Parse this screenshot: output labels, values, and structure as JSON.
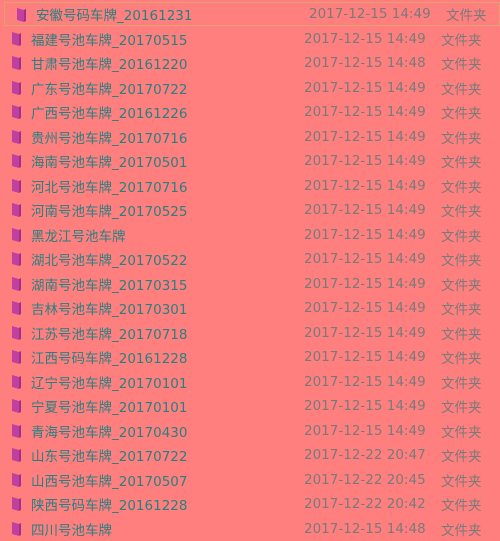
{
  "colors": {
    "background": "#ff7f7f",
    "name_text": "#2a8080",
    "meta_text": "#7a7a7a",
    "folder_icon": "#c040a0"
  },
  "files": [
    {
      "name": "安徽号码车牌_20161231",
      "date": "2017-12-15 14:49",
      "type": "文件夹",
      "selected": true
    },
    {
      "name": "福建号池车牌_20170515",
      "date": "2017-12-15 14:49",
      "type": "文件夹"
    },
    {
      "name": "甘肃号池车牌_20161220",
      "date": "2017-12-15 14:48",
      "type": "文件夹"
    },
    {
      "name": "广东号池车牌_20170722",
      "date": "2017-12-15 14:49",
      "type": "文件夹"
    },
    {
      "name": "广西号池车牌_20161226",
      "date": "2017-12-15 14:49",
      "type": "文件夹"
    },
    {
      "name": "贵州号池车牌_20170716",
      "date": "2017-12-15 14:49",
      "type": "文件夹"
    },
    {
      "name": "海南号池车牌_20170501",
      "date": "2017-12-15 14:49",
      "type": "文件夹"
    },
    {
      "name": "河北号池车牌_20170716",
      "date": "2017-12-15 14:49",
      "type": "文件夹"
    },
    {
      "name": "河南号池车牌_20170525",
      "date": "2017-12-15 14:49",
      "type": "文件夹"
    },
    {
      "name": "黑龙江号池车牌",
      "date": "2017-12-15 14:49",
      "type": "文件夹"
    },
    {
      "name": "湖北号池车牌_20170522",
      "date": "2017-12-15 14:49",
      "type": "文件夹"
    },
    {
      "name": "湖南号池车牌_20170315",
      "date": "2017-12-15 14:49",
      "type": "文件夹"
    },
    {
      "name": "吉林号池车牌_20170301",
      "date": "2017-12-15 14:49",
      "type": "文件夹"
    },
    {
      "name": "江苏号池车牌_20170718",
      "date": "2017-12-15 14:49",
      "type": "文件夹"
    },
    {
      "name": "江西号码车牌_20161228",
      "date": "2017-12-15 14:49",
      "type": "文件夹"
    },
    {
      "name": "辽宁号池车牌_20170101",
      "date": "2017-12-15 14:49",
      "type": "文件夹"
    },
    {
      "name": "宁夏号池车牌_20170101",
      "date": "2017-12-15 14:49",
      "type": "文件夹"
    },
    {
      "name": "青海号池车牌_20170430",
      "date": "2017-12-15 14:49",
      "type": "文件夹"
    },
    {
      "name": "山东号池车牌_20170722",
      "date": "2017-12-22 20:47",
      "type": "文件夹"
    },
    {
      "name": "山西号池车牌_20170507",
      "date": "2017-12-22 20:45",
      "type": "文件夹"
    },
    {
      "name": "陕西号码车牌_20161228",
      "date": "2017-12-22 20:42",
      "type": "文件夹"
    },
    {
      "name": "四川号池车牌",
      "date": "2017-12-15 14:48",
      "type": "文件夹"
    }
  ]
}
